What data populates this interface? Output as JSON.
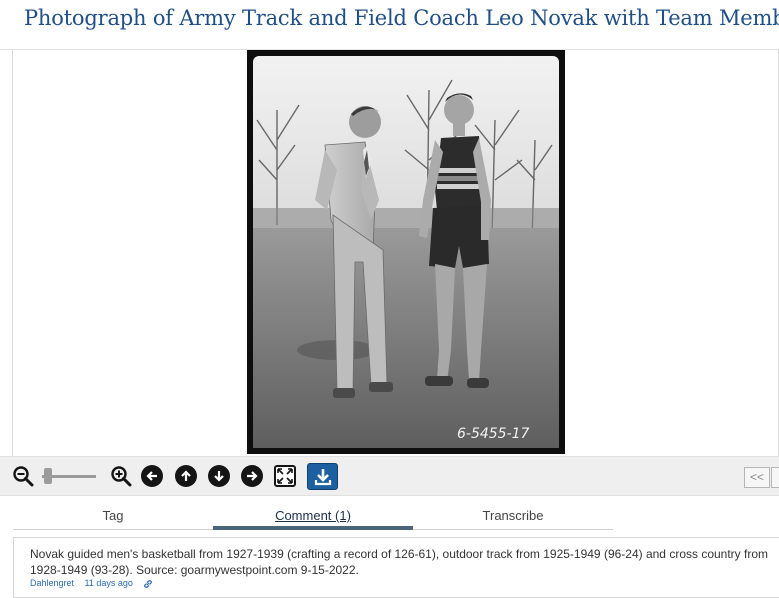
{
  "page": {
    "title": "Photograph of Army Track and Field Coach Leo Novak with Team Member"
  },
  "photo": {
    "inscription": "6-5455-17"
  },
  "toolbar": {
    "icons": [
      "zoom-out-icon",
      "zoom-in-icon",
      "arrow-left-icon",
      "arrow-up-icon",
      "arrow-down-icon",
      "arrow-right-icon",
      "fit-screen-icon",
      "download-icon"
    ],
    "pager_prev_label": "<<"
  },
  "tabs": [
    {
      "label": "Tag",
      "active": false
    },
    {
      "label": "Comment (1)",
      "active": true
    },
    {
      "label": "Transcribe",
      "active": false
    }
  ],
  "comment": {
    "text": "Novak guided men's basketball from 1927-1939 (crafting a record of 126-61), outdoor track from 1925-1949 (96-24) and cross country from 1928-1949 (93-28). Source: goarmywestpoint.com 9-15-2022.",
    "author": "Dahlengret",
    "time": "11 days ago"
  },
  "colors": {
    "title": "#1f4f86",
    "download_button": "#1e5fa0",
    "active_tab_underline": "#4a6677",
    "link": "#2a6bb3"
  }
}
